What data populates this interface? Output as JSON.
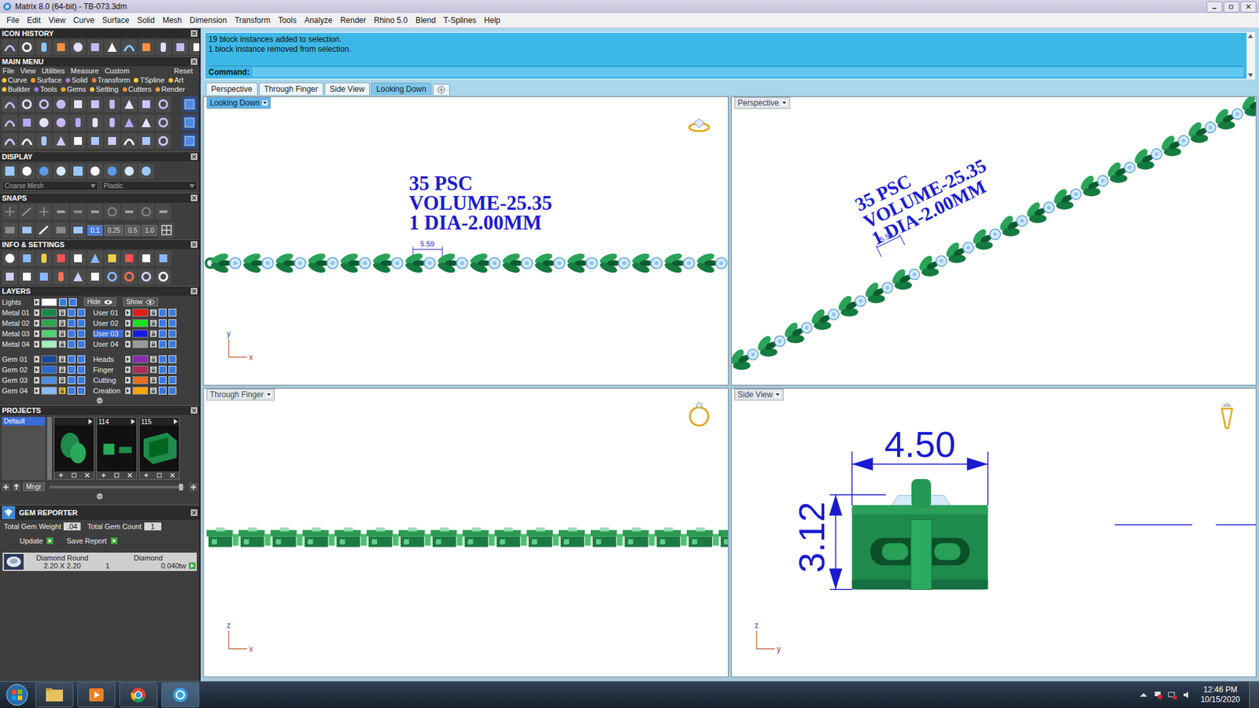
{
  "window": {
    "title": "Matrix 8.0 (64-bit) - TB-073.3dm"
  },
  "menu_bar": [
    "File",
    "Edit",
    "View",
    "Curve",
    "Surface",
    "Solid",
    "Mesh",
    "Dimension",
    "Transform",
    "Tools",
    "Analyze",
    "Render",
    "Rhino 5.0",
    "Blend",
    "T-Splines",
    "Help"
  ],
  "sidebar": {
    "icon_history": {
      "title": "ICON HISTORY"
    },
    "main_menu": {
      "title": "MAIN MENU",
      "menu": [
        "File",
        "View",
        "Utilities",
        "Measure",
        "Custom"
      ],
      "reset": "Reset",
      "categories": [
        {
          "label": "Curve",
          "color": "#f2c531"
        },
        {
          "label": "Surface",
          "color": "#f29a31"
        },
        {
          "label": "Solid",
          "color": "#b07ad8"
        },
        {
          "label": "Transform",
          "color": "#f27a31"
        },
        {
          "label": "TSpline",
          "color": "#f2d531"
        },
        {
          "label": "Art",
          "color": "#f2c531"
        },
        {
          "label": "Builder",
          "color": "#f2c531"
        },
        {
          "label": "Tools",
          "color": "#9a7ad8"
        },
        {
          "label": "Gems",
          "color": "#f2a531"
        },
        {
          "label": "Setting",
          "color": "#f2c531"
        },
        {
          "label": "Cutters",
          "color": "#f28a31"
        },
        {
          "label": "Render",
          "color": "#f29a31"
        }
      ]
    },
    "display": {
      "title": "DISPLAY",
      "mesh": "Coarse Mesh",
      "material": "Plastic"
    },
    "snaps": {
      "title": "SNAPS",
      "steps": [
        {
          "label": "0.1",
          "selected": true
        },
        {
          "label": "0.25",
          "selected": false
        },
        {
          "label": "0.5",
          "selected": false
        },
        {
          "label": "1.0",
          "selected": false
        }
      ]
    },
    "info": {
      "title": "INFO & SETTINGS"
    },
    "layers": {
      "title": "LAYERS",
      "lights": {
        "name": "Lights",
        "color": "#ffffff"
      },
      "hide": "Hide",
      "show": "Show",
      "left": [
        {
          "name": "Metal 01",
          "color": "#138a4a",
          "selected": false,
          "locked": false
        },
        {
          "name": "Metal 02",
          "color": "#2fa552",
          "selected": false,
          "locked": false
        },
        {
          "name": "Metal 03",
          "color": "#4fd274",
          "selected": false,
          "locked": false
        },
        {
          "name": "Metal 04",
          "color": "#a6ecbc",
          "selected": false,
          "locked": false
        },
        {
          "name": "Gem 01",
          "color": "#1a4a9e",
          "selected": false,
          "locked": false
        },
        {
          "name": "Gem 02",
          "color": "#2a6ad0",
          "selected": false,
          "locked": false
        },
        {
          "name": "Gem 03",
          "color": "#4a8ee2",
          "selected": false,
          "locked": false
        },
        {
          "name": "Gem 04",
          "color": "#8cbcf2",
          "selected": false,
          "locked": true
        }
      ],
      "right": [
        {
          "name": "User 01",
          "color": "#e41b1b",
          "selected": false,
          "locked": false
        },
        {
          "name": "User 02",
          "color": "#1ee01e",
          "selected": false,
          "locked": false
        },
        {
          "name": "User 03",
          "color": "#1b1be4",
          "selected": true,
          "locked": false
        },
        {
          "name": "User 04",
          "color": "#9a9a9a",
          "selected": false,
          "locked": false
        },
        {
          "name": "Heads",
          "color": "#8a2ab0",
          "selected": false,
          "locked": false
        },
        {
          "name": "Finger",
          "color": "#b02a5a",
          "selected": false,
          "locked": false
        },
        {
          "name": "Cutting",
          "color": "#e87020",
          "selected": false,
          "locked": false
        },
        {
          "name": "Creation",
          "color": "#f0a800",
          "selected": false,
          "locked": false
        }
      ]
    },
    "projects": {
      "title": "PROJECTS",
      "items": [
        {
          "label": "Default",
          "selected": true
        }
      ],
      "thumbnails": [
        {
          "label": "",
          "kind": "ring"
        },
        {
          "label": "114",
          "kind": "part"
        },
        {
          "label": "115",
          "kind": "box"
        }
      ],
      "manager": "Mngr"
    },
    "gem_reporter": {
      "title": "GEM REPORTER",
      "total_weight_label": "Total Gem Weight",
      "total_weight": ".04",
      "total_count_label": "Total Gem Count",
      "total_count": "1",
      "update": "Update",
      "save": "Save Report",
      "gems": [
        {
          "shape": "Diamond Round",
          "size": "2.20 X 2.20",
          "material": "Diamond",
          "count": "1",
          "weight": "0.040tw"
        }
      ]
    }
  },
  "command": {
    "history": [
      "19 block instances added to selection.",
      "1 block instance removed from selection."
    ],
    "prompt": "Command:"
  },
  "view_tabs": [
    {
      "label": "Perspective",
      "selected": false
    },
    {
      "label": "Through Finger",
      "selected": false
    },
    {
      "label": "Side View",
      "selected": false
    },
    {
      "label": "Looking Down",
      "selected": true
    }
  ],
  "viewports": [
    {
      "label": "Looking Down",
      "active": true,
      "kind": "top",
      "axes": [
        "y",
        "x"
      ],
      "annotations": [
        "35 PSC",
        "VOLUME-25.35",
        "1 DIA-2.00MM"
      ],
      "dimension": "5.59"
    },
    {
      "label": "Perspective",
      "active": false,
      "kind": "perspective",
      "axes": [],
      "annotations": [
        "35 PSC",
        "VOLUME-25.35",
        "1 DIA-2.00MM"
      ],
      "dimension": "5.59"
    },
    {
      "label": "Through Finger",
      "active": false,
      "kind": "front",
      "axes": [
        "z",
        "x"
      ]
    },
    {
      "label": "Side View",
      "active": false,
      "kind": "side",
      "axes": [
        "z",
        "y"
      ],
      "width": "4.50",
      "height": "3.12"
    }
  ],
  "taskbar": {
    "time": "12:46 PM",
    "date": "10/15/2020"
  }
}
